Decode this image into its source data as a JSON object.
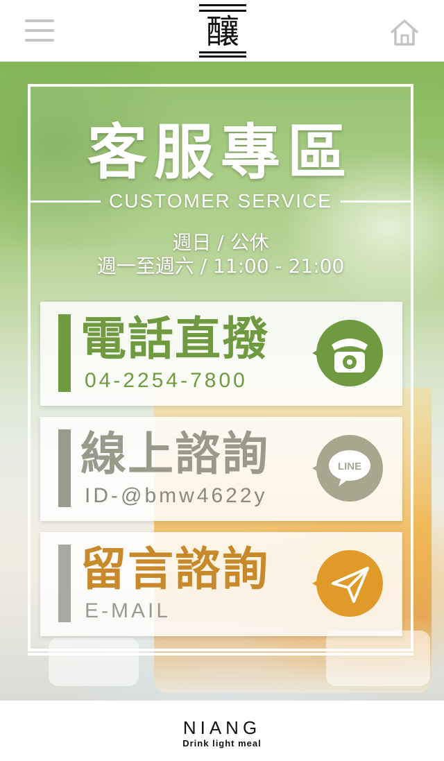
{
  "header": {
    "logo_text": "釀",
    "menu_icon": "hamburger-menu-icon",
    "home_icon": "home-icon"
  },
  "hero": {
    "title": "客服專區",
    "subtitle": "CUSTOMER SERVICE",
    "hours_line1": "週日 / 公休",
    "hours_line2": "週一至週六 / 11:00 - 21:00"
  },
  "contacts": [
    {
      "label": "電話直撥",
      "value": "04-2254-7800",
      "icon": "telephone-icon",
      "color": "#6f9a3f"
    },
    {
      "label": "線上諮詢",
      "value": "ID-@bmw4622y",
      "icon": "line-chat-icon",
      "icon_text": "LINE",
      "color": "#9a9a8a"
    },
    {
      "label": "留言諮詢",
      "value": "E-MAIL",
      "icon": "paper-plane-icon",
      "color": "#c8892a"
    }
  ],
  "footer": {
    "brand": "NIANG",
    "tagline": "Drink light meal"
  }
}
